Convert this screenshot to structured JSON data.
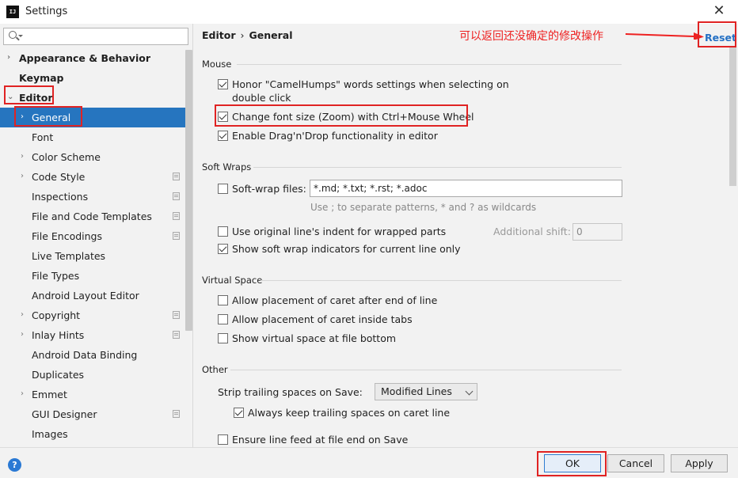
{
  "window": {
    "title": "Settings",
    "app_icon_text": "IJ"
  },
  "search": {
    "placeholder": ""
  },
  "sidebar": {
    "items": [
      {
        "label": "Appearance & Behavior"
      },
      {
        "label": "Keymap"
      },
      {
        "label": "Editor"
      },
      {
        "label": "General"
      },
      {
        "label": "Font"
      },
      {
        "label": "Color Scheme"
      },
      {
        "label": "Code Style"
      },
      {
        "label": "Inspections"
      },
      {
        "label": "File and Code Templates"
      },
      {
        "label": "File Encodings"
      },
      {
        "label": "Live Templates"
      },
      {
        "label": "File Types"
      },
      {
        "label": "Android Layout Editor"
      },
      {
        "label": "Copyright"
      },
      {
        "label": "Inlay Hints"
      },
      {
        "label": "Android Data Binding"
      },
      {
        "label": "Duplicates"
      },
      {
        "label": "Emmet"
      },
      {
        "label": "GUI Designer"
      },
      {
        "label": "Images"
      }
    ]
  },
  "breadcrumb": {
    "parent": "Editor",
    "separator": "›",
    "current": "General"
  },
  "annotation": {
    "text": "可以返回还没确定的修改操作"
  },
  "reset_label": "Reset",
  "mouse": {
    "heading": "Mouse",
    "camelhumps_line1": "Honor \"CamelHumps\" words settings when selecting on",
    "camelhumps_line2": "double click",
    "zoom": "Change font size (Zoom) with Ctrl+Mouse Wheel",
    "dragdrop": "Enable Drag'n'Drop functionality in editor"
  },
  "soft_wraps": {
    "heading": "Soft Wraps",
    "files_label": "Soft-wrap files:",
    "files_value": "*.md; *.txt; *.rst; *.adoc",
    "hint": "Use ; to separate patterns, * and ? as wildcards",
    "original_indent": "Use original line's indent for wrapped parts",
    "additional_shift_label": "Additional shift:",
    "additional_shift_value": "0",
    "show_indicators": "Show soft wrap indicators for current line only"
  },
  "virtual_space": {
    "heading": "Virtual Space",
    "after_end": "Allow placement of caret after end of line",
    "inside_tabs": "Allow placement of caret inside tabs",
    "file_bottom": "Show virtual space at file bottom"
  },
  "other": {
    "heading": "Other",
    "strip_label": "Strip trailing spaces on Save:",
    "strip_value": "Modified Lines",
    "keep_trailing": "Always keep trailing spaces on caret line",
    "line_feed": "Ensure line feed at file end on Save"
  },
  "footer": {
    "help": "?",
    "ok": "OK",
    "cancel": "Cancel",
    "apply": "Apply"
  }
}
